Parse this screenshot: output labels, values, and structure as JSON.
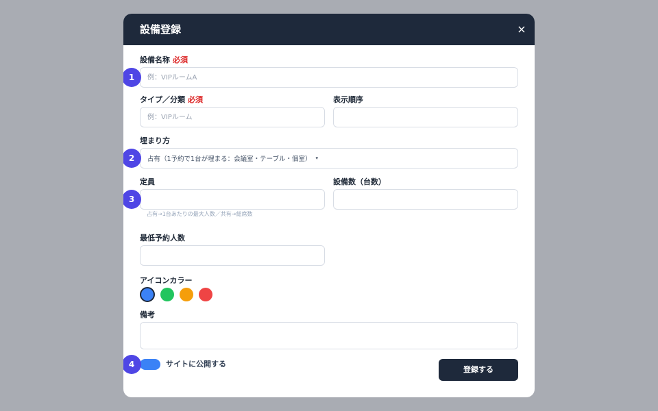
{
  "dialog": {
    "title": "設備登録",
    "close_icon": "×"
  },
  "form": {
    "name": {
      "label": "設備名称",
      "required": "必須",
      "placeholder": "例：VIPルームA",
      "step": "1"
    },
    "type": {
      "label": "タイプ／分類",
      "required": "必須",
      "placeholder": "例：VIPルーム"
    },
    "display_order": {
      "label": "表示順序",
      "value": ""
    },
    "fill_mode": {
      "label": "埋まり方",
      "selected": "占有（1予約で1台が埋まる：会議室・テーブル・個室）",
      "caret": "▾",
      "step": "2"
    },
    "capacity": {
      "label": "定員",
      "value": "",
      "hint": "占有→1台あたりの最大人数／共有→総席数",
      "step": "3"
    },
    "unit_count": {
      "label": "設備数（台数）",
      "value": ""
    },
    "min_people": {
      "label": "最低予約人数",
      "value": ""
    },
    "icon_color": {
      "label": "アイコンカラー",
      "colors": [
        "#3b82f6",
        "#22c55e",
        "#f59e0b",
        "#ef4444"
      ],
      "selected_index": 0
    },
    "notes": {
      "label": "備考",
      "value": ""
    },
    "publish": {
      "label": "サイトに公開する",
      "enabled": true,
      "step": "4"
    },
    "submit_label": "登録する"
  },
  "colors": {
    "header_bg": "#1e293b",
    "accent": "#4f46e5",
    "required": "#dc2626",
    "toggle_on": "#3b82f6"
  }
}
